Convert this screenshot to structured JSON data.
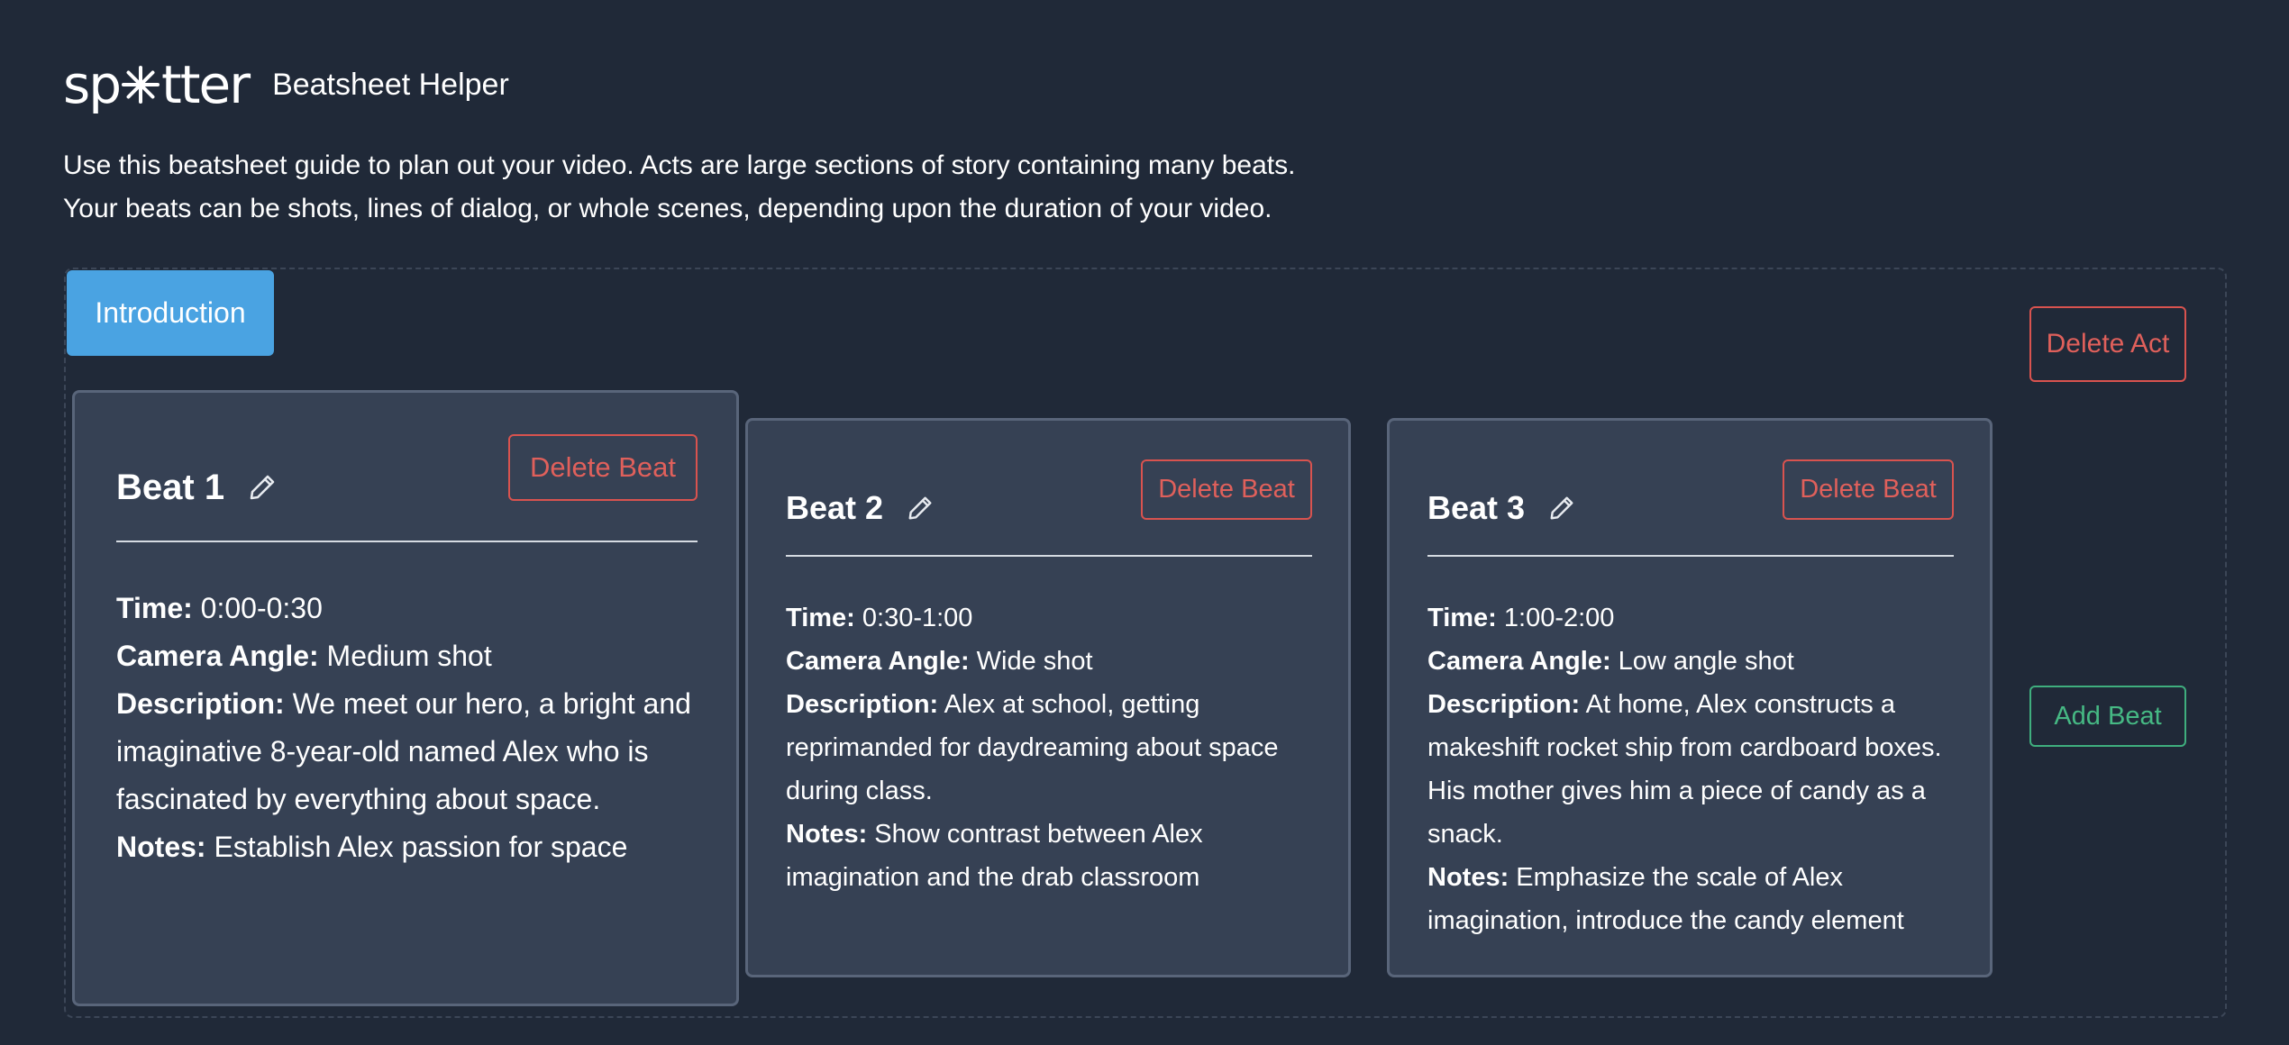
{
  "header": {
    "logo_left": "sp",
    "logo_right": "tter",
    "app_title": "Beatsheet Helper"
  },
  "intro": {
    "line1": "Use this beatsheet guide to plan out your video. Acts are large sections of story containing many beats.",
    "line2": "Your beats can be shots, lines of dialog, or whole scenes, depending upon the duration of your video."
  },
  "act": {
    "title": "Introduction",
    "delete_label": "Delete Act",
    "add_beat_label": "Add Beat"
  },
  "labels": {
    "time": "Time:",
    "camera": "Camera Angle:",
    "description": "Description:",
    "notes": "Notes:"
  },
  "beats": [
    {
      "title": "Beat 1",
      "delete_label": "Delete Beat",
      "time": "0:00-0:30",
      "camera": "Medium shot",
      "description": "We meet our hero, a bright and imaginative 8-year-old named Alex who is fascinated by everything about space.",
      "notes": "Establish Alex passion for space"
    },
    {
      "title": "Beat 2",
      "delete_label": "Delete Beat",
      "time": "0:30-1:00",
      "camera": "Wide shot",
      "description": "Alex at school, getting reprimanded for daydreaming about space during class.",
      "notes": "Show contrast between Alex imagination and the drab classroom"
    },
    {
      "title": "Beat 3",
      "delete_label": "Delete Beat",
      "time": "1:00-2:00",
      "camera": "Low angle shot",
      "description": "At home, Alex constructs a makeshift rocket ship from cardboard boxes. His mother gives him a piece of candy as a snack.",
      "notes": "Emphasize the scale of Alex imagination, introduce the candy element"
    }
  ],
  "icons": {
    "logo_star": "asterisk-star-icon",
    "edit": "pencil-icon"
  },
  "colors": {
    "background": "#202938",
    "card": "#364154",
    "accent_blue": "#4aa3e2",
    "danger": "#d9534f",
    "success": "#3fae7e"
  }
}
